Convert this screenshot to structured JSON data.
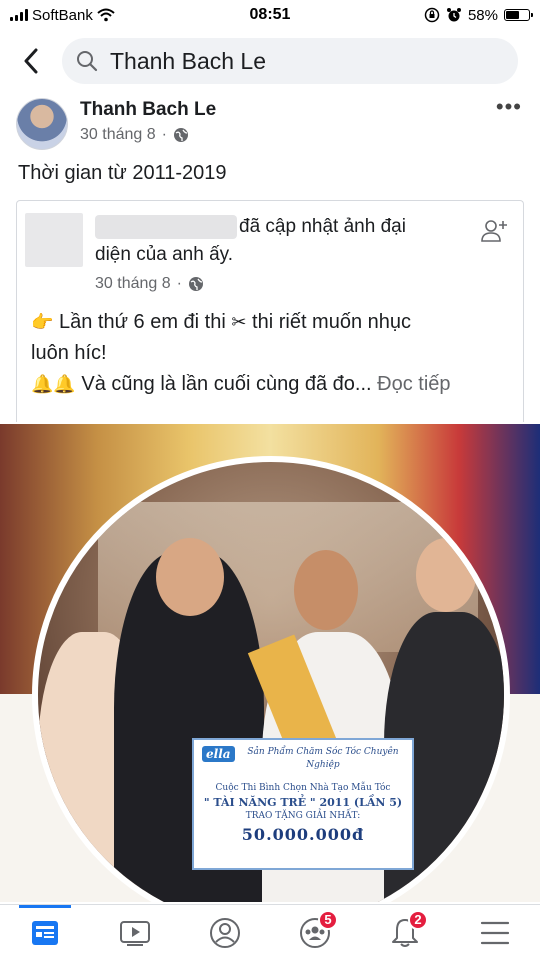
{
  "status_bar": {
    "carrier": "SoftBank",
    "time": "08:51",
    "battery_percent": "58%",
    "battery_level": 0.58
  },
  "search": {
    "value": "Thanh Bach Le"
  },
  "post": {
    "author": "Thanh Bach Le",
    "time": "30 tháng 8",
    "text": "Thời gian từ 2011-2019"
  },
  "shared_post": {
    "action_line_1": "đã cập nhật ảnh đại",
    "action_line_2": "diện của anh ấy.",
    "time": "30 tháng 8",
    "body_line_1": "Lần thứ 6 em đi thi",
    "body_line_1b": "thi riết muốn nhục",
    "body_line_2": "luôn híc!",
    "body_line_3": "Và cũng là lần cuối cùng đã đo...",
    "see_more": "Đọc tiếp"
  },
  "photo": {
    "check_brand": "ella",
    "check_header": "Sản Phẩm Chăm Sóc Tóc Chuyên Nghiệp",
    "check_line_1": "Cuộc Thi Bình Chọn Nhà Tạo Mẫu Tóc",
    "check_line_2": "\" TÀI NĂNG TRẺ \" 2011 (LẦN 5)",
    "check_line_3": "TRAO TẶNG GIẢI NHẤT:",
    "check_amount": "50.000.000đ"
  },
  "bottom_nav": {
    "items": [
      {
        "icon": "news-feed-icon",
        "badge": ""
      },
      {
        "icon": "watch-icon",
        "badge": ""
      },
      {
        "icon": "profile-icon",
        "badge": ""
      },
      {
        "icon": "groups-icon",
        "badge": "5"
      },
      {
        "icon": "notifications-icon",
        "badge": "2"
      },
      {
        "icon": "menu-icon",
        "badge": ""
      }
    ]
  },
  "colors": {
    "accent": "#1877f2",
    "badge": "#e41e3f",
    "secondary_text": "#65676b"
  }
}
